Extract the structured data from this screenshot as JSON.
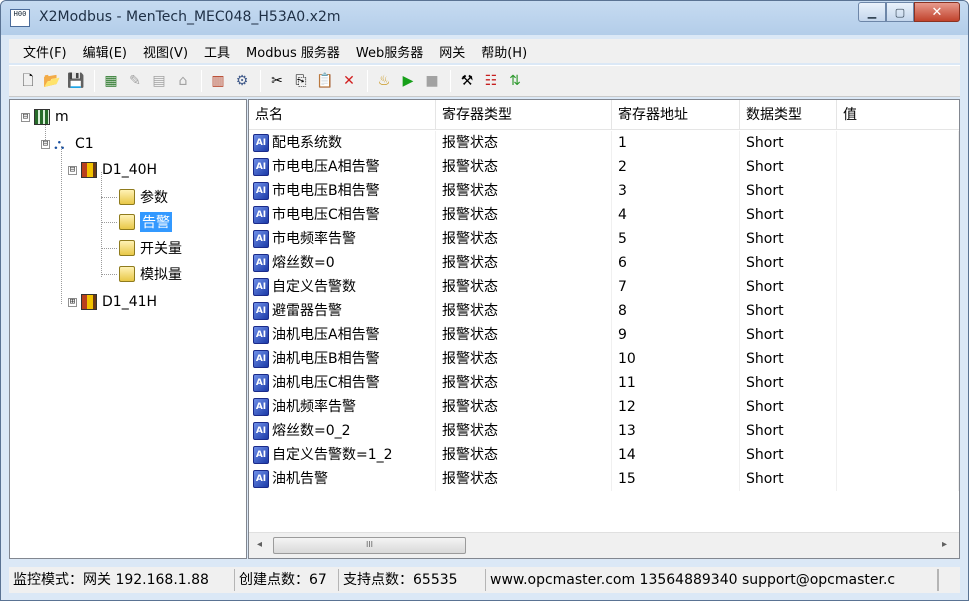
{
  "window": {
    "title": "X2Modbus - MenTech_MEC048_H53A0.x2m",
    "icon_text": "H00",
    "controls": [
      "minimize-icon",
      "maximize-icon",
      "close-icon"
    ]
  },
  "menu": [
    "文件(F)",
    "编辑(E)",
    "视图(V)",
    "工具",
    "Modbus 服务器",
    "Web服务器",
    "网关",
    "帮助(H)"
  ],
  "toolbar": {
    "icons": [
      "new-icon",
      "open-icon",
      "save-icon",
      "add-icon",
      "edit-icon",
      "properties-icon",
      "disabled-icon",
      "device-icon",
      "settings-icon",
      "cut-icon",
      "copy-icon",
      "paste-icon",
      "delete-icon",
      "monitor-icon",
      "run-icon",
      "stop-icon",
      "tools-icon",
      "log-icon",
      "transfer-icon"
    ]
  },
  "tree": {
    "root": {
      "label": "m",
      "expander": "⊟"
    },
    "channel": {
      "label": "C1",
      "expander": "⊟"
    },
    "device1": {
      "label": "D1_40H",
      "expander": "⊟"
    },
    "folders": [
      {
        "label": "参数"
      },
      {
        "label": "告警"
      },
      {
        "label": "开关量"
      },
      {
        "label": "模拟量"
      }
    ],
    "device2": {
      "label": "D1_41H",
      "expander": "⊞"
    }
  },
  "table": {
    "columns": [
      "点名",
      "寄存器类型",
      "寄存器地址",
      "数据类型",
      "值"
    ],
    "rows": [
      {
        "name": "配电系统数",
        "reg_type": "报警状态",
        "address": "1",
        "data_type": "Short",
        "value": ""
      },
      {
        "name": "市电电压A相告警",
        "reg_type": "报警状态",
        "address": "2",
        "data_type": "Short",
        "value": ""
      },
      {
        "name": "市电电压B相告警",
        "reg_type": "报警状态",
        "address": "3",
        "data_type": "Short",
        "value": ""
      },
      {
        "name": "市电电压C相告警",
        "reg_type": "报警状态",
        "address": "4",
        "data_type": "Short",
        "value": ""
      },
      {
        "name": "市电频率告警",
        "reg_type": "报警状态",
        "address": "5",
        "data_type": "Short",
        "value": ""
      },
      {
        "name": "熔丝数=0",
        "reg_type": "报警状态",
        "address": "6",
        "data_type": "Short",
        "value": ""
      },
      {
        "name": "自定义告警数",
        "reg_type": "报警状态",
        "address": "7",
        "data_type": "Short",
        "value": ""
      },
      {
        "name": "避雷器告警",
        "reg_type": "报警状态",
        "address": "8",
        "data_type": "Short",
        "value": ""
      },
      {
        "name": "油机电压A相告警",
        "reg_type": "报警状态",
        "address": "9",
        "data_type": "Short",
        "value": ""
      },
      {
        "name": "油机电压B相告警",
        "reg_type": "报警状态",
        "address": "10",
        "data_type": "Short",
        "value": ""
      },
      {
        "name": "油机电压C相告警",
        "reg_type": "报警状态",
        "address": "11",
        "data_type": "Short",
        "value": ""
      },
      {
        "name": "油机频率告警",
        "reg_type": "报警状态",
        "address": "12",
        "data_type": "Short",
        "value": ""
      },
      {
        "name": "熔丝数=0_2",
        "reg_type": "报警状态",
        "address": "13",
        "data_type": "Short",
        "value": ""
      },
      {
        "name": "自定义告警数=1_2",
        "reg_type": "报警状态",
        "address": "14",
        "data_type": "Short",
        "value": ""
      },
      {
        "name": "油机告警",
        "reg_type": "报警状态",
        "address": "15",
        "data_type": "Short",
        "value": ""
      }
    ]
  },
  "scrollbar": {
    "thumb_label": "III"
  },
  "status": {
    "mode": "监控模式：网关 192.168.1.88",
    "created": "创建点数：67",
    "supported": "支持点数：65535",
    "contact": "www.opcmaster.com 13564889340 support@opcmaster.c"
  },
  "colors": {
    "selection": "#3399ff",
    "titlebar": "#b9d1ea",
    "close_button": "#c7432f"
  }
}
